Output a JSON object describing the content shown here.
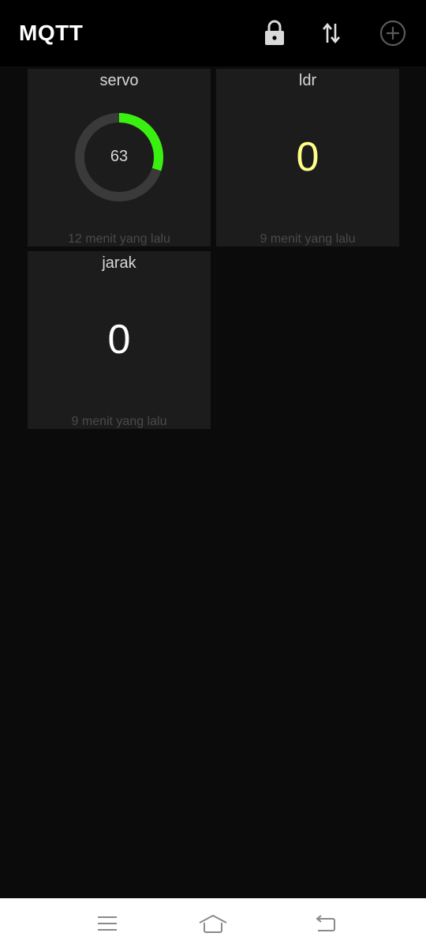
{
  "app": {
    "title": "MQTT"
  },
  "toolbar": {
    "lock_icon": "lock-icon",
    "sync_icon": "arrows-up-down-icon",
    "add_icon": "add-circle-icon"
  },
  "tiles": [
    {
      "title": "servo",
      "type": "gauge",
      "value": "63",
      "gauge_fraction": 0.3,
      "accent": "#39f011",
      "footer": "12 menit yang lalu"
    },
    {
      "title": "ldr",
      "type": "text",
      "value": "0",
      "accent": "#ffff88",
      "footer": "9 menit yang lalu"
    },
    {
      "title": "jarak",
      "type": "text",
      "value": "0",
      "accent": "#ffffff",
      "footer": "9 menit yang lalu"
    }
  ],
  "nav": {
    "menu_icon": "menu-icon",
    "home_icon": "home-icon",
    "back_icon": "back-icon"
  },
  "colors": {
    "background": "#0b0b0b",
    "tile": "#1c1c1c",
    "gauge_track": "#3a3a3a"
  }
}
